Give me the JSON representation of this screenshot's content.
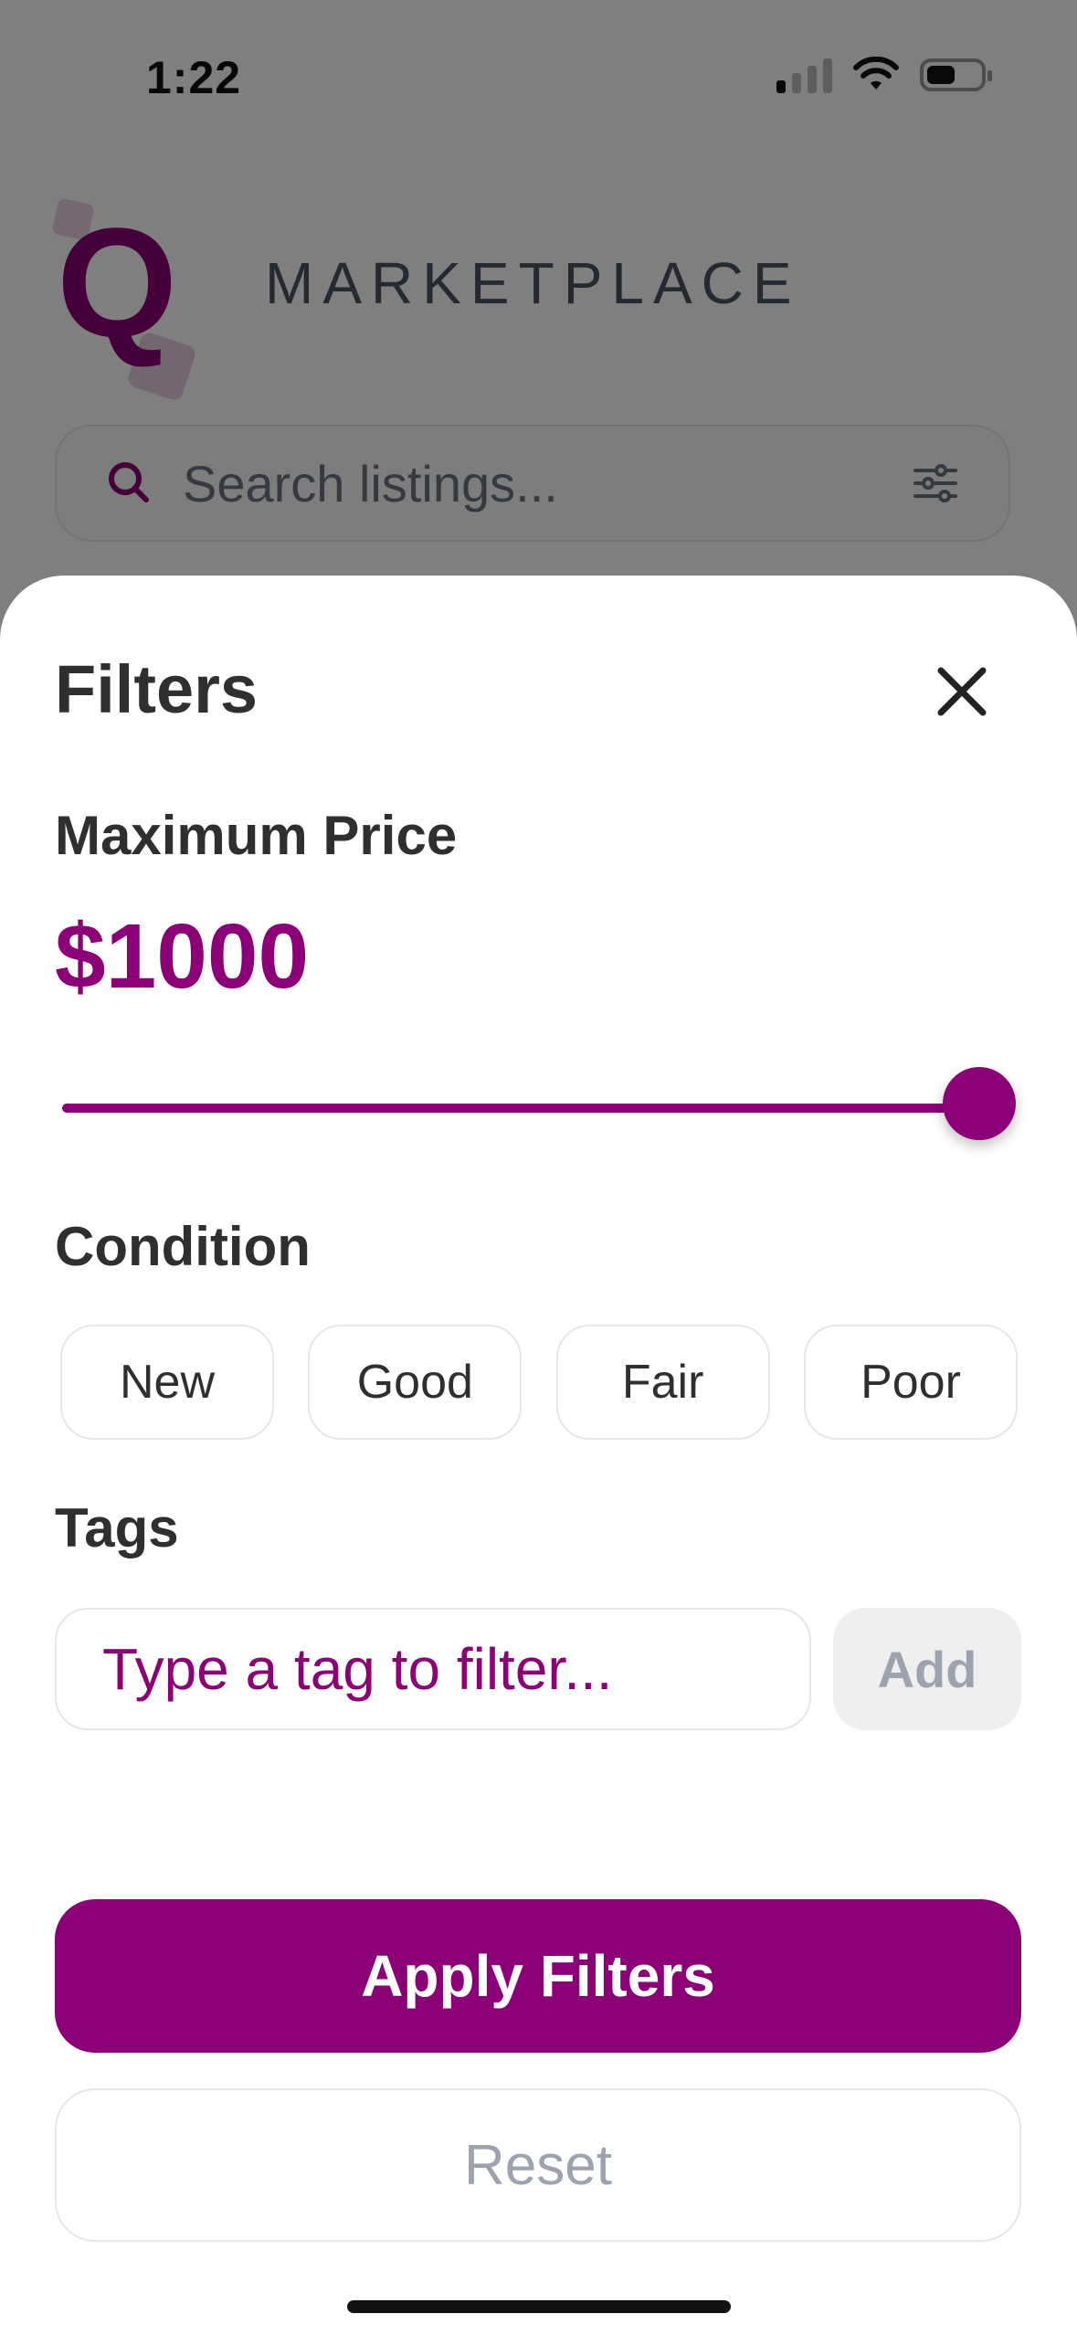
{
  "status_bar": {
    "time": "1:22"
  },
  "app": {
    "brand": "MARKETPLACE",
    "logo_letter": "Q"
  },
  "search": {
    "placeholder": "Search listings..."
  },
  "filters": {
    "title": "Filters",
    "max_price_label": "Maximum Price",
    "max_price_value": "$1000",
    "slider_fraction": 1.0,
    "condition_label": "Condition",
    "conditions": [
      "New",
      "Good",
      "Fair",
      "Poor"
    ],
    "tags_label": "Tags",
    "tag_placeholder": "Type a tag to filter...",
    "add_label": "Add",
    "apply_label": "Apply Filters",
    "reset_label": "Reset"
  },
  "colors": {
    "accent": "#8b0077",
    "text": "#2f2f2f",
    "muted": "#9ca3af"
  },
  "icons": [
    "search-icon",
    "filter-settings-icon",
    "close-icon",
    "wifi-icon",
    "cellular-signal-icon",
    "battery-icon"
  ]
}
